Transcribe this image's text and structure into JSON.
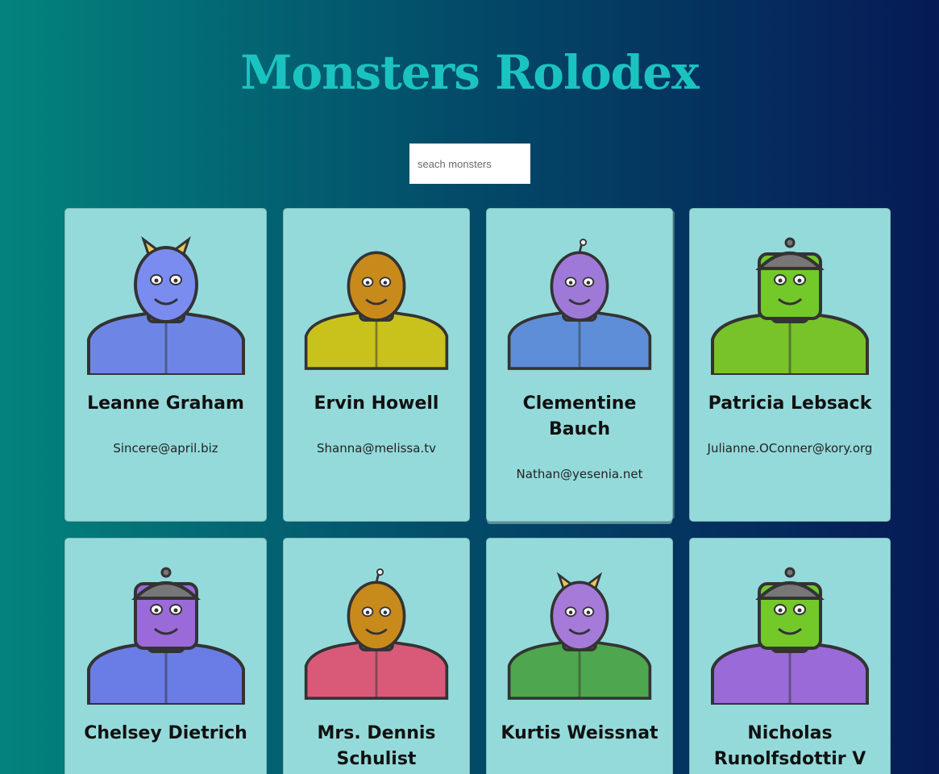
{
  "app": {
    "title": "Monsters Rolodex"
  },
  "search": {
    "placeholder": "seach monsters",
    "value": ""
  },
  "colors": {
    "background_left": "#03837e",
    "background_right": "#061a56",
    "title": "#1bc3c0",
    "card": "#95dada"
  },
  "monsters": [
    {
      "name": "Leanne Graham",
      "email": "Sincere@april.biz",
      "skin": "#7b8cf0",
      "body": "#6d86e6",
      "head": "horns"
    },
    {
      "name": "Ervin Howell",
      "email": "Shanna@melissa.tv",
      "skin": "#c98a1c",
      "body": "#c9c21c",
      "head": "bald"
    },
    {
      "name": "Clementine Bauch",
      "email": "Nathan@yesenia.net",
      "skin": "#9f79d8",
      "body": "#5f8ed8",
      "head": "antenna"
    },
    {
      "name": "Patricia Lebsack",
      "email": "Julianne.OConner@kory.org",
      "skin": "#73c82a",
      "body": "#78c22a",
      "head": "helmet"
    },
    {
      "name": "Chelsey Dietrich",
      "email": "",
      "skin": "#9a6ad8",
      "body": "#6a7ce6",
      "head": "helmet"
    },
    {
      "name": "Mrs. Dennis Schulist",
      "email": "",
      "skin": "#c98a1c",
      "body": "#d85a78",
      "head": "antenna"
    },
    {
      "name": "Kurtis Weissnat",
      "email": "",
      "skin": "#a57ad8",
      "body": "#4ea64e",
      "head": "horns"
    },
    {
      "name": "Nicholas Runolfsdottir V",
      "email": "",
      "skin": "#73c82a",
      "body": "#9a6ad8",
      "head": "helmet"
    }
  ]
}
